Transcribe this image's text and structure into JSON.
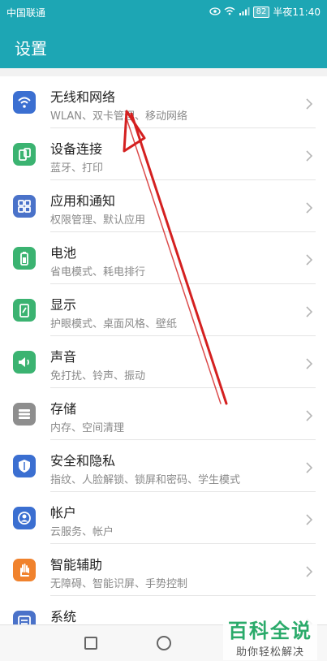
{
  "status_bar": {
    "carrier": "中国联通",
    "battery": "82",
    "time": "半夜11:40",
    "icons": [
      "eye-icon",
      "wifi-icon",
      "signal-icon",
      "battery-icon"
    ]
  },
  "app_bar": {
    "title": "设置"
  },
  "settings": [
    {
      "title": "无线和网络",
      "subtitle": "WLAN、双卡管理、移动网络",
      "icon": "wifi-icon",
      "color": "#3b6fd1"
    },
    {
      "title": "设备连接",
      "subtitle": "蓝牙、打印",
      "icon": "device-connect-icon",
      "color": "#3bb371"
    },
    {
      "title": "应用和通知",
      "subtitle": "权限管理、默认应用",
      "icon": "apps-icon",
      "color": "#4a72c9"
    },
    {
      "title": "电池",
      "subtitle": "省电模式、耗电排行",
      "icon": "battery-icon",
      "color": "#3bb371"
    },
    {
      "title": "显示",
      "subtitle": "护眼模式、桌面风格、壁纸",
      "icon": "display-icon",
      "color": "#3bb371"
    },
    {
      "title": "声音",
      "subtitle": "免打扰、铃声、振动",
      "icon": "sound-icon",
      "color": "#3bb371"
    },
    {
      "title": "存储",
      "subtitle": "内存、空间清理",
      "icon": "storage-icon",
      "color": "#8e8e8e"
    },
    {
      "title": "安全和隐私",
      "subtitle": "指纹、人脸解锁、锁屏和密码、学生模式",
      "icon": "shield-icon",
      "color": "#3b6fd1"
    },
    {
      "title": "帐户",
      "subtitle": "云服务、帐户",
      "icon": "account-icon",
      "color": "#3b6fd1"
    },
    {
      "title": "智能辅助",
      "subtitle": "无障碍、智能识屏、手势控制",
      "icon": "hand-icon",
      "color": "#f0822d"
    },
    {
      "title": "系统",
      "subtitle": "",
      "icon": "system-icon",
      "color": "#4a72c9"
    }
  ],
  "nav_bar": {
    "icons": [
      "back-icon",
      "recents-icon",
      "home-icon"
    ]
  },
  "watermark": {
    "main": "百科全说",
    "sub": "助你轻松解决"
  },
  "annotation": {
    "color": "#d42020"
  }
}
